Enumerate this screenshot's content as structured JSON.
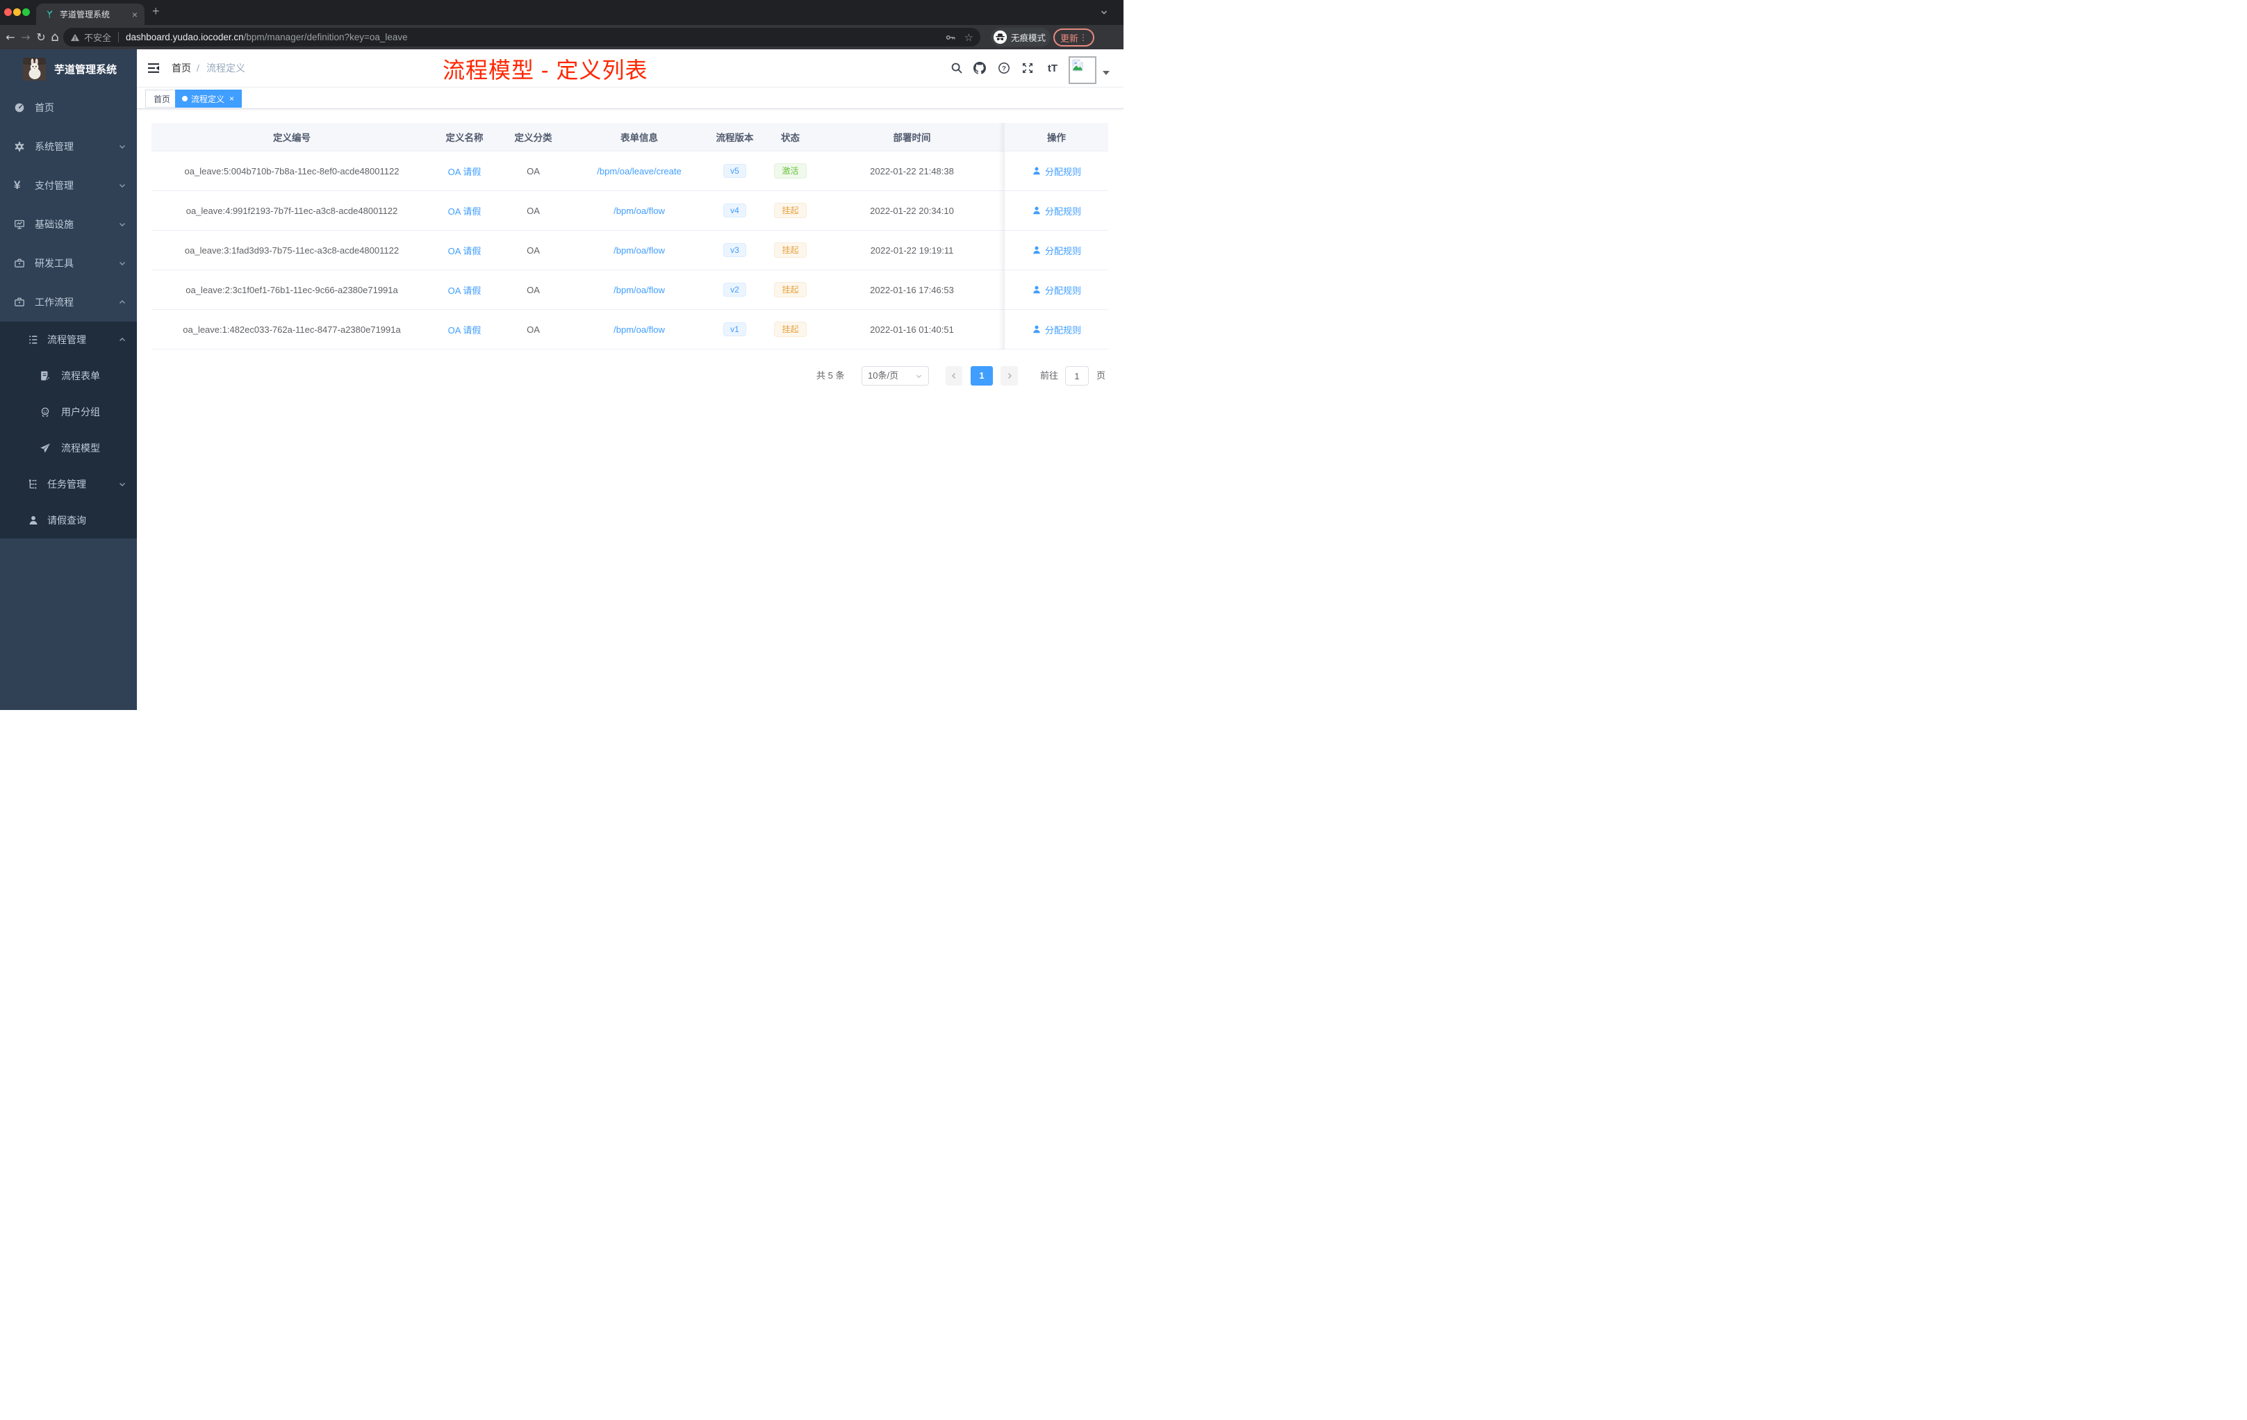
{
  "colors": {
    "accent": "#409eff",
    "success": "#67c23a",
    "warning": "#e6a23c",
    "annotation": "#ff2600",
    "sidebar": "#304156",
    "submenu": "#1f2d3d"
  },
  "browser": {
    "tab": {
      "title": "芋道管理系统",
      "close": "×",
      "new_tab": "+"
    },
    "address": {
      "security": "不安全",
      "domain": "dashboard.yudao.iocoder.cn",
      "path": "/bpm/manager/definition?key=oa_leave"
    },
    "incognito_label": "无痕模式",
    "update_label": "更新",
    "menu_dots": "⋮",
    "star": "☆"
  },
  "sidebar": {
    "app_title": "芋道管理系统",
    "items": [
      {
        "label": "首页"
      },
      {
        "label": "系统管理"
      },
      {
        "label": "支付管理"
      },
      {
        "label": "基础设施"
      },
      {
        "label": "研发工具"
      },
      {
        "label": "工作流程"
      },
      {
        "label": "流程管理"
      },
      {
        "label": "流程表单"
      },
      {
        "label": "用户分组"
      },
      {
        "label": "流程模型"
      },
      {
        "label": "任务管理"
      },
      {
        "label": "请假查询"
      }
    ],
    "yen_glyph": "¥"
  },
  "header": {
    "breadcrumb_home": "首页",
    "breadcrumb_sep": "/",
    "breadcrumb_current": "流程定义",
    "font_button": "tT"
  },
  "annotation": {
    "title": "流程模型 - 定义列表"
  },
  "tags": {
    "home": "首页",
    "active": "流程定义",
    "close": "×"
  },
  "table": {
    "columns": [
      "定义编号",
      "定义名称",
      "定义分类",
      "表单信息",
      "流程版本",
      "状态",
      "部署时间",
      "操作"
    ],
    "rows": [
      {
        "id": "oa_leave:5:004b710b-7b8a-11ec-8ef0-acde48001122",
        "name": "OA 请假",
        "category": "OA",
        "form": "/bpm/oa/leave/create",
        "version": "v5",
        "status": "激活",
        "time": "2022-01-22 21:48:38",
        "action": "分配规则"
      },
      {
        "id": "oa_leave:4:991f2193-7b7f-11ec-a3c8-acde48001122",
        "name": "OA 请假",
        "category": "OA",
        "form": "/bpm/oa/flow",
        "version": "v4",
        "status": "挂起",
        "time": "2022-01-22 20:34:10",
        "action": "分配规则"
      },
      {
        "id": "oa_leave:3:1fad3d93-7b75-11ec-a3c8-acde48001122",
        "name": "OA 请假",
        "category": "OA",
        "form": "/bpm/oa/flow",
        "version": "v3",
        "status": "挂起",
        "time": "2022-01-22 19:19:11",
        "action": "分配规则"
      },
      {
        "id": "oa_leave:2:3c1f0ef1-76b1-11ec-9c66-a2380e71991a",
        "name": "OA 请假",
        "category": "OA",
        "form": "/bpm/oa/flow",
        "version": "v2",
        "status": "挂起",
        "time": "2022-01-16 17:46:53",
        "action": "分配规则"
      },
      {
        "id": "oa_leave:1:482ec033-762a-11ec-8477-a2380e71991a",
        "name": "OA 请假",
        "category": "OA",
        "form": "/bpm/oa/flow",
        "version": "v1",
        "status": "挂起",
        "time": "2022-01-16 01:40:51",
        "action": "分配规则"
      }
    ]
  },
  "pagination": {
    "total": "共 5 条",
    "page_size": "10条/页",
    "page": "1",
    "goto": "前往",
    "goto_value": "1",
    "unit": "页"
  }
}
